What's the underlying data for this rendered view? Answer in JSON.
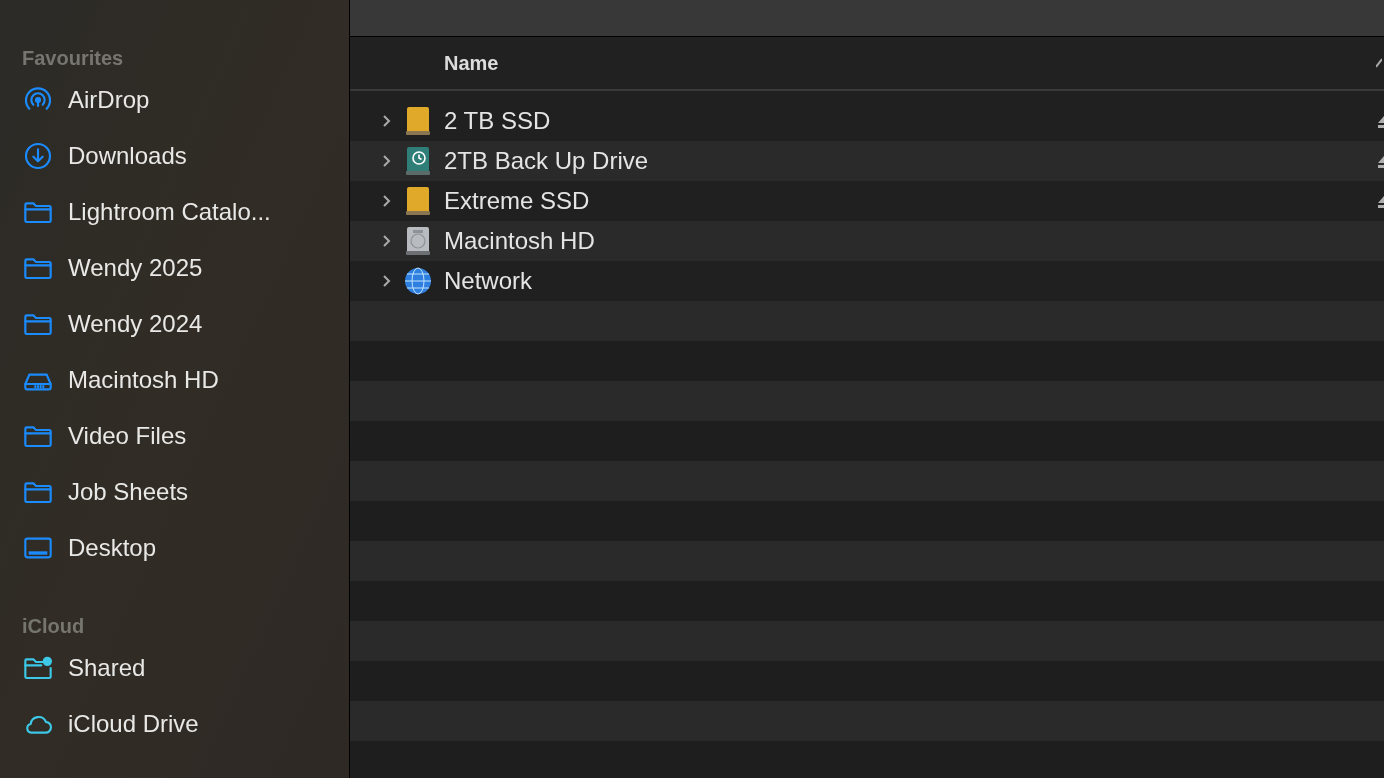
{
  "sidebar": {
    "sections": [
      {
        "title": "Favourites",
        "kind": "favourites",
        "items": [
          {
            "label": "AirDrop",
            "kind": "airdrop"
          },
          {
            "label": "Downloads",
            "kind": "download"
          },
          {
            "label": "Lightroom Catalo...",
            "kind": "folder"
          },
          {
            "label": "Wendy 2025",
            "kind": "folder"
          },
          {
            "label": "Wendy 2024",
            "kind": "folder"
          },
          {
            "label": "Macintosh HD",
            "kind": "drive"
          },
          {
            "label": "Video Files",
            "kind": "folder"
          },
          {
            "label": "Job Sheets",
            "kind": "folder"
          },
          {
            "label": "Desktop",
            "kind": "desktop"
          }
        ]
      },
      {
        "title": "iCloud",
        "kind": "icloud",
        "items": [
          {
            "label": "Shared",
            "kind": "shared"
          },
          {
            "label": "iCloud Drive",
            "kind": "cloud"
          }
        ]
      }
    ]
  },
  "table": {
    "columns": [
      "Name"
    ],
    "rows": [
      {
        "name": "2 TB SSD",
        "kind": "external",
        "expanded": false,
        "ejectable": true
      },
      {
        "name": "2TB Back Up Drive",
        "kind": "backup",
        "expanded": false,
        "ejectable": true
      },
      {
        "name": "Extreme SSD",
        "kind": "external",
        "expanded": false,
        "ejectable": true
      },
      {
        "name": "Macintosh HD",
        "kind": "internal",
        "expanded": false,
        "ejectable": false
      },
      {
        "name": "Network",
        "kind": "network",
        "expanded": false,
        "ejectable": false
      }
    ]
  }
}
